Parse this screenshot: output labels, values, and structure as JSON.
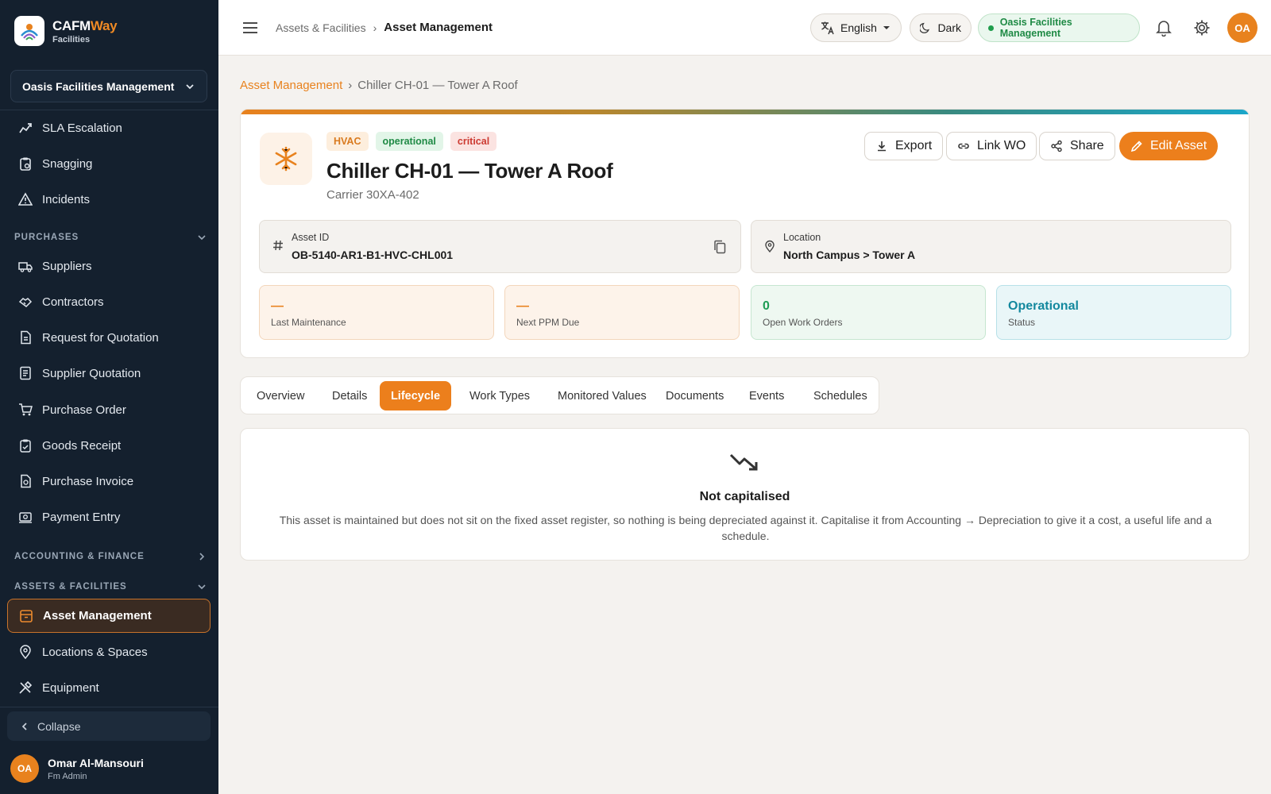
{
  "brand": {
    "name_a": "CAFM",
    "name_b": "Way",
    "sub": "Facilities",
    "accent": "#f08a24"
  },
  "org_select": {
    "label": "Oasis Facilities Management"
  },
  "sidebar": {
    "items_top": [
      {
        "label": "SLA Escalation",
        "icon": "sla-escalation-icon"
      },
      {
        "label": "Snagging",
        "icon": "clipboard-icon"
      },
      {
        "label": "Incidents",
        "icon": "warning-triangle-icon"
      }
    ],
    "purchases": {
      "title": "PURCHASES",
      "items": [
        {
          "label": "Suppliers",
          "icon": "truck-icon"
        },
        {
          "label": "Contractors",
          "icon": "handshake-icon"
        },
        {
          "label": "Request for Quotation",
          "icon": "document-icon"
        },
        {
          "label": "Supplier Quotation",
          "icon": "quotation-icon"
        },
        {
          "label": "Purchase Order",
          "icon": "cart-icon"
        },
        {
          "label": "Goods Receipt",
          "icon": "receipt-icon"
        },
        {
          "label": "Purchase Invoice",
          "icon": "invoice-icon"
        },
        {
          "label": "Payment Entry",
          "icon": "payment-icon"
        }
      ]
    },
    "accounting_title": "ACCOUNTING & FINANCE",
    "assets": {
      "title": "ASSETS & FACILITIES",
      "items": [
        {
          "label": "Asset Management",
          "icon": "archive-icon",
          "active": true
        },
        {
          "label": "Locations & Spaces",
          "icon": "location-pin-icon"
        },
        {
          "label": "Equipment",
          "icon": "tools-icon"
        }
      ]
    },
    "collapse_label": "Collapse"
  },
  "user": {
    "initials": "OA",
    "name": "Omar Al-Mansouri",
    "role": "Fm Admin"
  },
  "topbar": {
    "breadcrumb_parent": "Assets & Facilities",
    "breadcrumb_current": "Asset Management",
    "language": "English",
    "theme": "Dark",
    "org": "Oasis Facilities Management",
    "avatar_initials": "OA"
  },
  "page_breadcrumb": {
    "parent": "Asset Management",
    "current": "Chiller CH-01 — Tower A Roof"
  },
  "asset": {
    "badges": {
      "category": "HVAC",
      "status": "operational",
      "priority": "critical"
    },
    "title": "Chiller CH-01 — Tower A Roof",
    "model": "Carrier 30XA-402",
    "actions": {
      "export": "Export",
      "link_wo": "Link WO",
      "share": "Share",
      "edit": "Edit Asset"
    },
    "asset_id_label": "Asset ID",
    "asset_id": "OB-5140-AR1-B1-HVC-CHL001",
    "location_label": "Location",
    "location": "North Campus > Tower A",
    "stats": [
      {
        "value": "—",
        "label": "Last Maintenance"
      },
      {
        "value": "—",
        "label": "Next PPM Due"
      },
      {
        "value": "0",
        "label": "Open Work Orders"
      },
      {
        "value": "Operational",
        "label": "Status"
      }
    ]
  },
  "tabs": [
    {
      "label": "Overview"
    },
    {
      "label": "Details"
    },
    {
      "label": "Lifecycle",
      "active": true
    },
    {
      "label": "Work Types"
    },
    {
      "label": "Monitored Values"
    },
    {
      "label": "Documents"
    },
    {
      "label": "Events"
    },
    {
      "label": "Schedules"
    }
  ],
  "lifecycle": {
    "title": "Not capitalised",
    "description": "This asset is maintained but does not sit on the fixed asset register, so nothing is being depreciated against it. Capitalise it from Accounting → Depreciation to give it a cost, a useful life and a schedule."
  },
  "colors": {
    "primary": "#ec7f1c",
    "sidebar_bg": "#14202e",
    "success": "#1f9d55",
    "info": "#13889e",
    "danger": "#cc3a31"
  }
}
